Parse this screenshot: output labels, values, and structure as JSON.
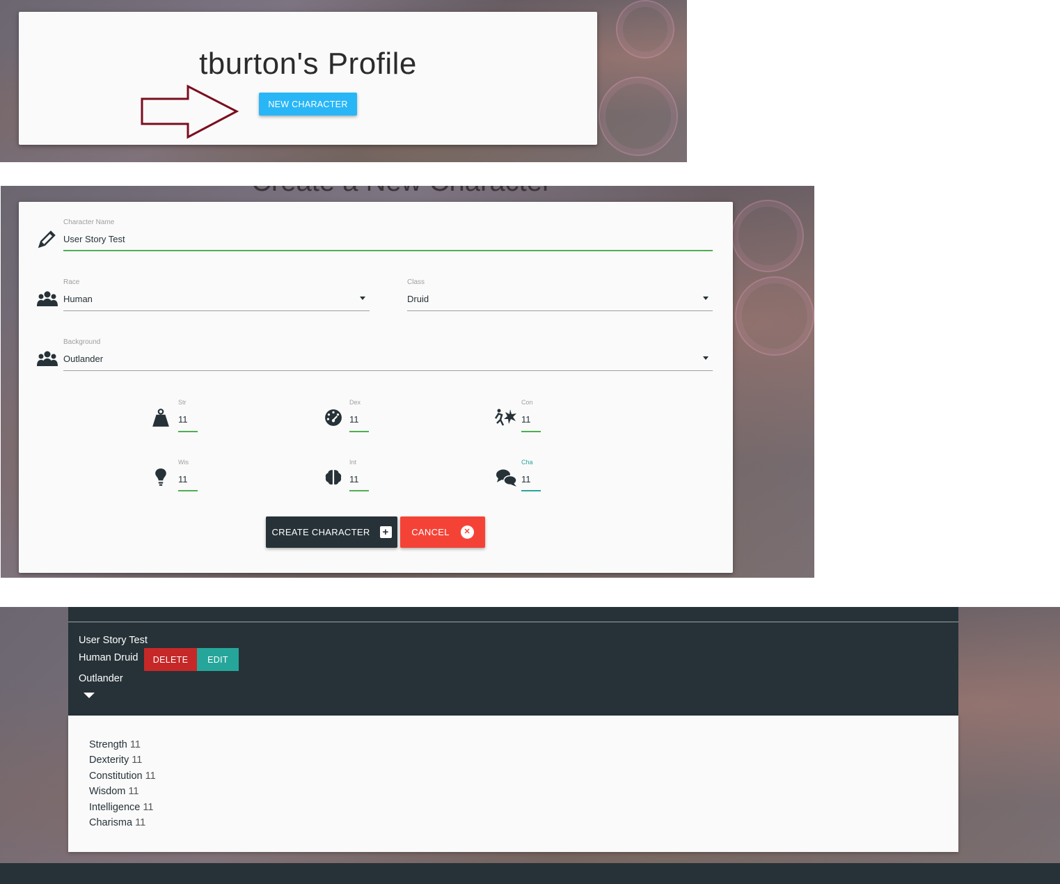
{
  "profile": {
    "title": "tburton's Profile",
    "new_character_label": "NEW CHARACTER",
    "annotation_color": "#7b0d1e"
  },
  "create_form": {
    "heading": "Create a New Character",
    "character_name": {
      "label": "Character Name",
      "value": "User Story Test",
      "icon": "pencil-icon"
    },
    "race": {
      "label": "Race",
      "value": "Human",
      "icon": "group-icon"
    },
    "class": {
      "label": "Class",
      "value": "Druid"
    },
    "background": {
      "label": "Background",
      "value": "Outlander",
      "icon": "group-icon"
    },
    "stats": [
      {
        "label": "Str",
        "value": "11",
        "icon": "weight-icon"
      },
      {
        "label": "Dex",
        "value": "11",
        "icon": "gauge-icon"
      },
      {
        "label": "Con",
        "value": "11",
        "icon": "impact-icon"
      },
      {
        "label": "Wis",
        "value": "11",
        "icon": "lightbulb-icon"
      },
      {
        "label": "Int",
        "value": "11",
        "icon": "brain-icon"
      },
      {
        "label": "Cha",
        "value": "11",
        "icon": "speech-bubbles-icon"
      }
    ],
    "create_label": "CREATE CHARACTER",
    "cancel_label": "CANCEL"
  },
  "character_card": {
    "name": "User Story Test",
    "race_class": "Human Druid",
    "background": "Outlander",
    "delete_label": "DELETE",
    "edit_label": "EDIT",
    "stats": [
      {
        "name": "Strength",
        "value": "11"
      },
      {
        "name": "Dexterity",
        "value": "11"
      },
      {
        "name": "Constitution",
        "value": "11"
      },
      {
        "name": "Wisdom",
        "value": "11"
      },
      {
        "name": "Intelligence",
        "value": "11"
      },
      {
        "name": "Charisma",
        "value": "11"
      }
    ]
  },
  "colors": {
    "primary_dark": "#263238",
    "light_blue": "#29b6f6",
    "red": "#f44336",
    "dark_red": "#c62828",
    "teal": "#26a69a",
    "green": "#4caf50"
  }
}
